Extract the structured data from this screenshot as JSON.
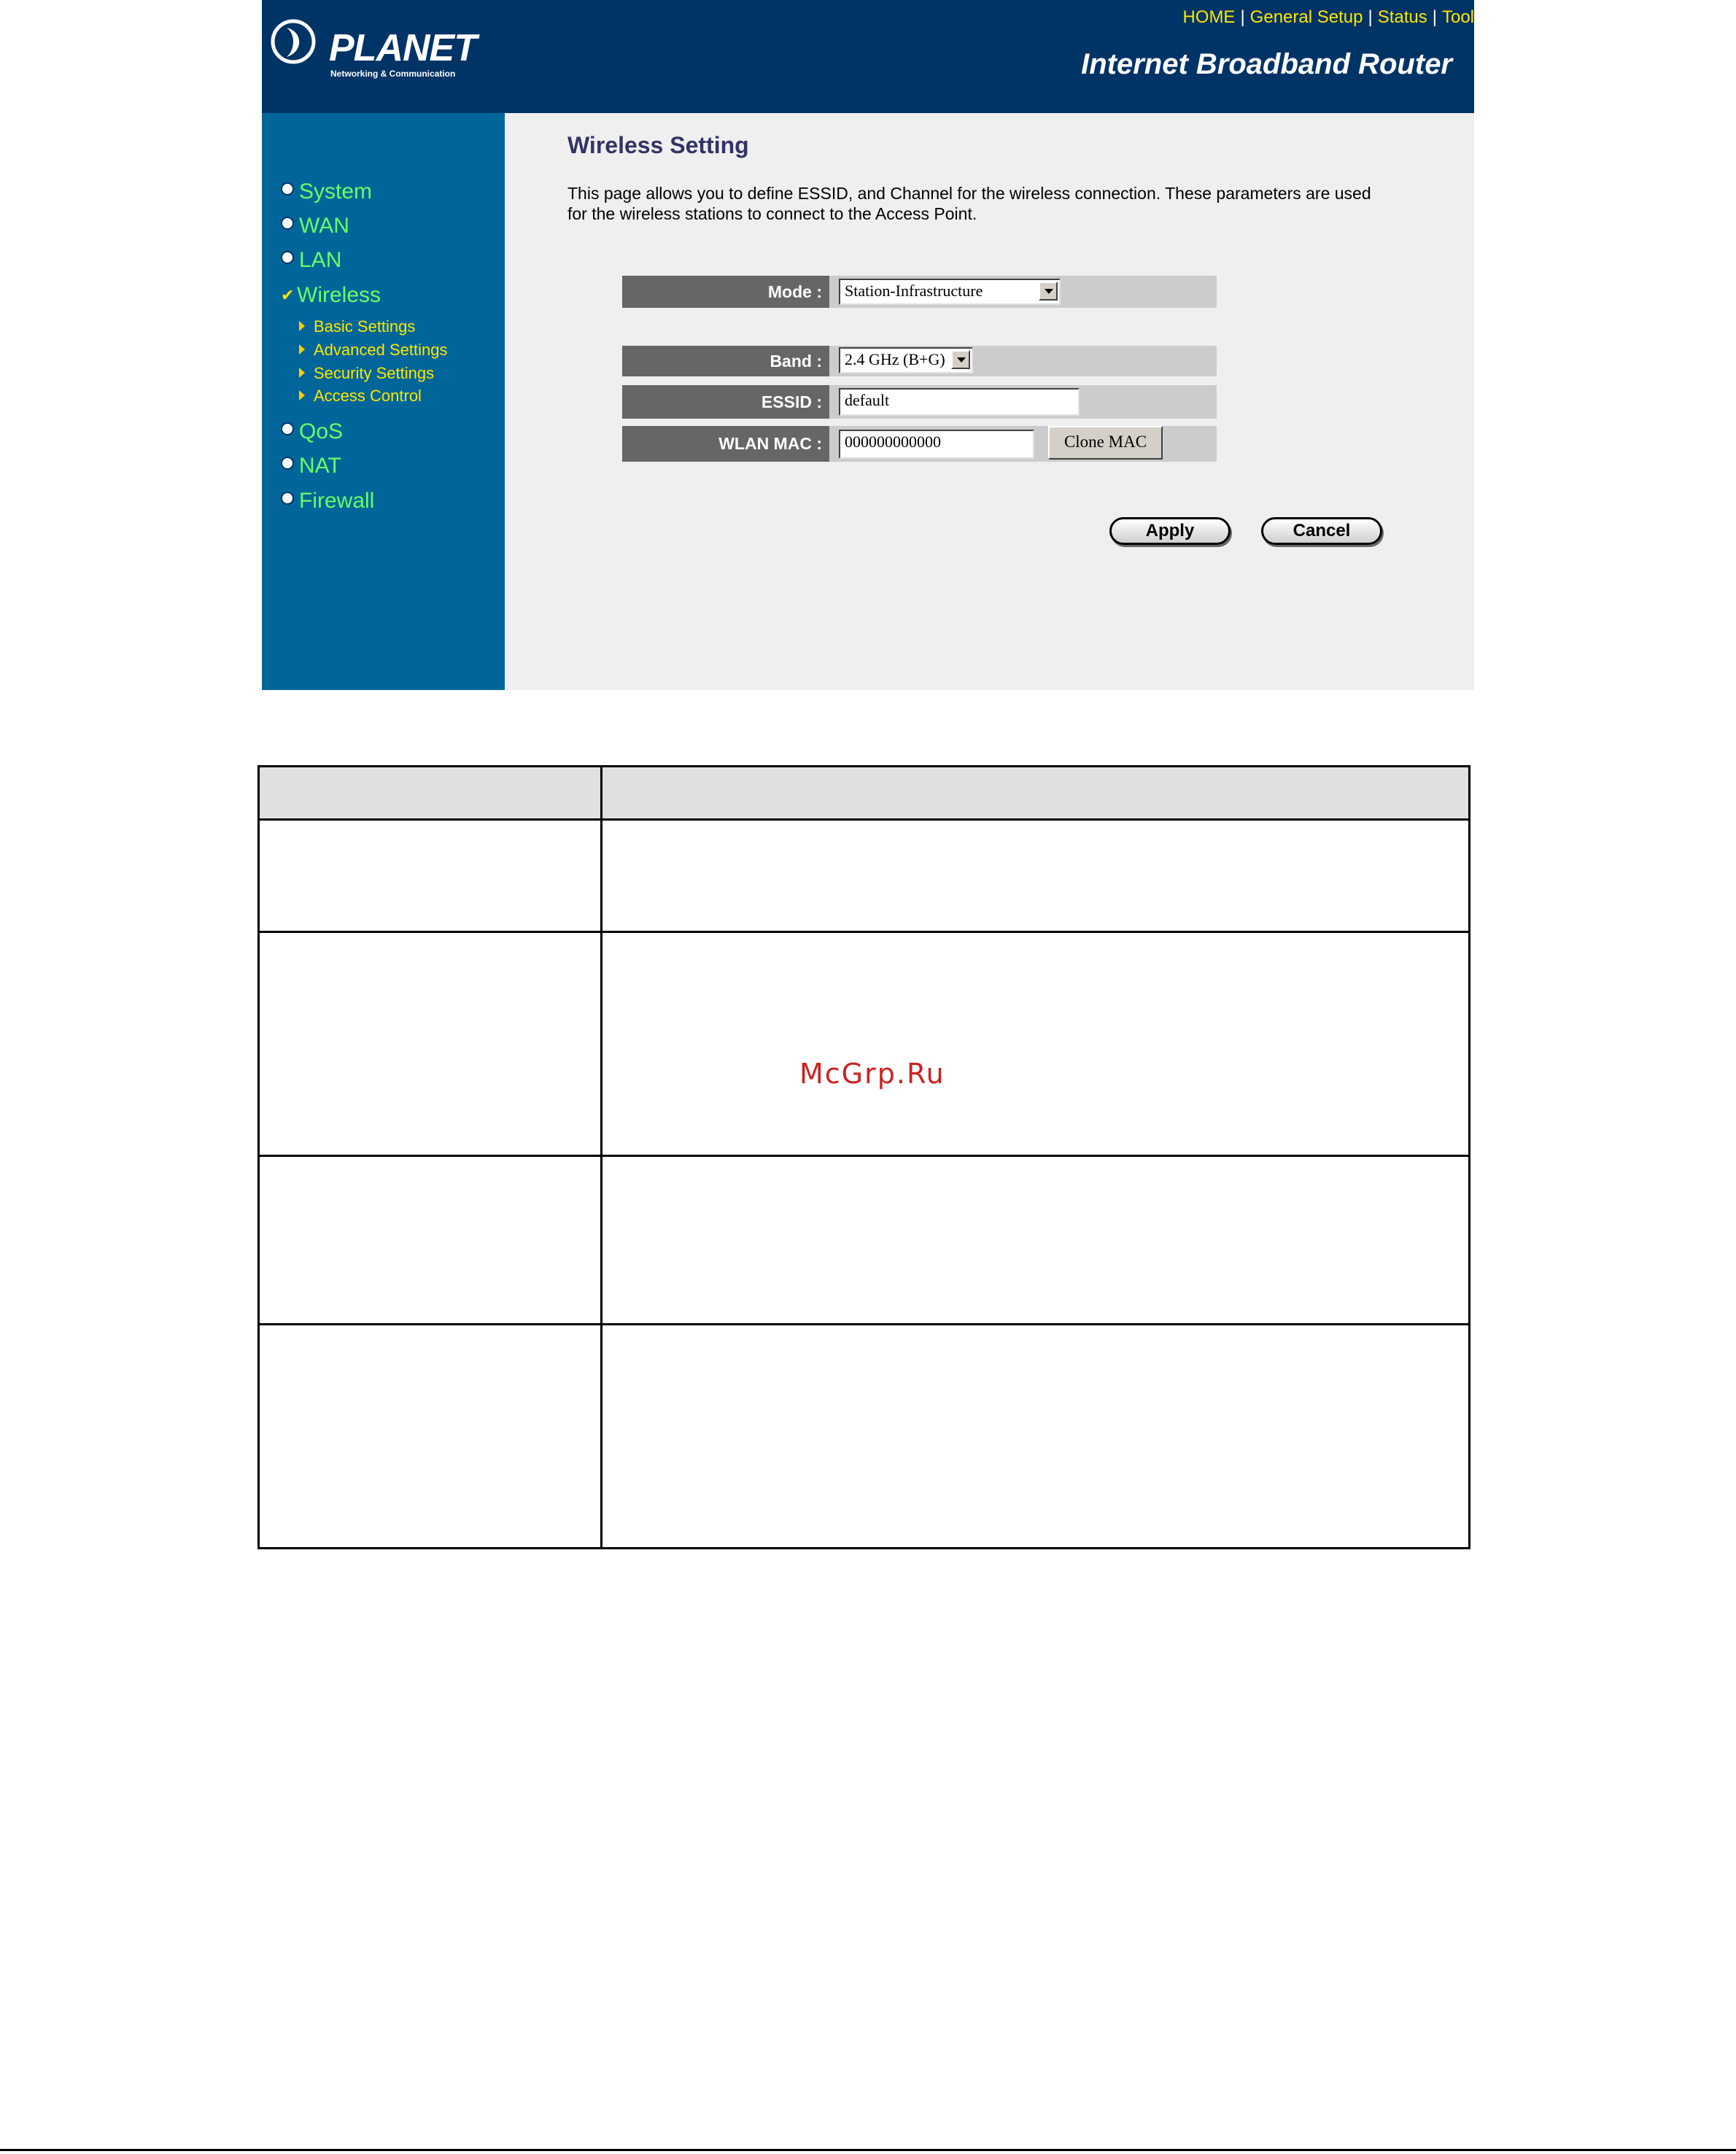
{
  "header": {
    "brand": "PLANET",
    "brand_sub": "Networking & Communication",
    "links": [
      "HOME",
      "General Setup",
      "Status",
      "Tool"
    ],
    "product_title": "Internet Broadband Router"
  },
  "sidebar": {
    "items": [
      {
        "label": "System",
        "checked": false
      },
      {
        "label": "WAN",
        "checked": false
      },
      {
        "label": "LAN",
        "checked": false
      },
      {
        "label": "Wireless",
        "checked": true
      },
      {
        "label": "QoS",
        "checked": false
      },
      {
        "label": "NAT",
        "checked": false
      },
      {
        "label": "Firewall",
        "checked": false
      }
    ],
    "wireless_sub": [
      "Basic Settings",
      "Advanced Settings",
      "Security Settings",
      "Access Control"
    ]
  },
  "main": {
    "title": "Wireless Setting",
    "description": "This page allows you to define ESSID, and Channel for the wireless connection. These parameters are used for the wireless stations to connect to the Access Point.",
    "form": {
      "mode_label": "Mode :",
      "mode_value": "Station-Infrastructure",
      "band_label": "Band :",
      "band_value": "2.4 GHz (B+G)",
      "essid_label": "ESSID :",
      "essid_value": "default",
      "wlan_mac_label": "WLAN MAC :",
      "wlan_mac_value": "000000000000",
      "clone_mac_label": "Clone MAC"
    },
    "apply_label": "Apply",
    "cancel_label": "Cancel"
  },
  "watermark": "McGrp.Ru",
  "colors": {
    "header_bg": "#003366",
    "sidebar_bg": "#006699",
    "nav_green": "#66ff66",
    "nav_yellow": "#ffe600",
    "content_bg": "#efefef",
    "label_bg": "#666666",
    "row_bg": "#cccccc",
    "watermark": "#cc2222"
  }
}
